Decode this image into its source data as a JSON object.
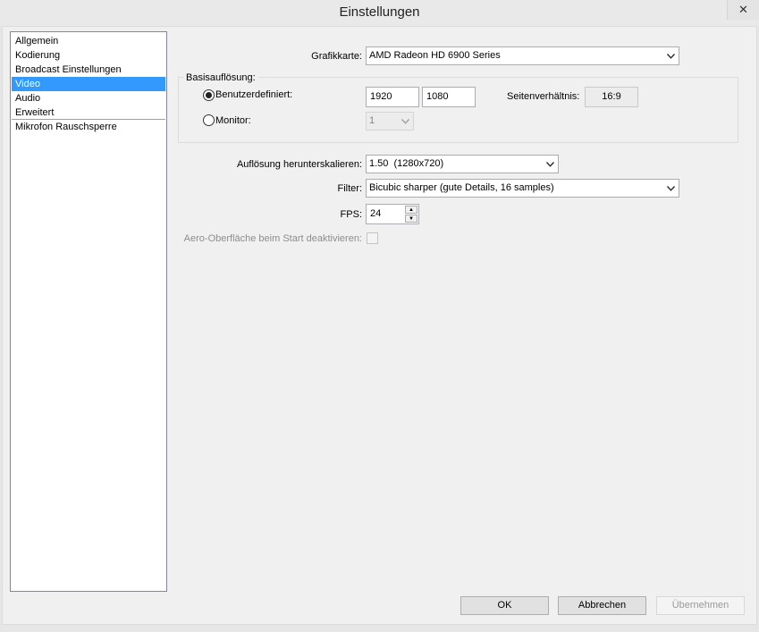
{
  "window": {
    "title": "Einstellungen",
    "close_glyph": "✕"
  },
  "nav": {
    "items": [
      {
        "label": "Allgemein"
      },
      {
        "label": "Kodierung"
      },
      {
        "label": "Broadcast Einstellungen"
      },
      {
        "label": "Video"
      },
      {
        "label": "Audio"
      },
      {
        "label": "Erweitert"
      },
      {
        "label": "Mikrofon Rauschsperre"
      }
    ],
    "selected": "Video"
  },
  "video": {
    "graphics_card": {
      "label": "Grafikkarte:",
      "value": "AMD Radeon HD 6900 Series"
    },
    "base_resolution": {
      "title": "Basisauflösung:",
      "custom_label": "Benutzerdefiniert:",
      "custom_selected": true,
      "width": "1920",
      "height": "1080",
      "aspect_label": "Seitenverhältnis:",
      "aspect_value": "16:9",
      "monitor_label": "Monitor:",
      "monitor_value": "1"
    },
    "downscale": {
      "label": "Auflösung herunterskalieren:",
      "value": "1.50  (1280x720)"
    },
    "filter": {
      "label": "Filter:",
      "value": "Bicubic sharper (gute Details, 16 samples)"
    },
    "fps": {
      "label": "FPS:",
      "value": "24"
    },
    "aero": {
      "label": "Aero-Oberfläche beim Start deaktivieren:",
      "checked": false
    }
  },
  "buttons": {
    "ok": "OK",
    "cancel": "Abbrechen",
    "apply": "Übernehmen"
  },
  "icons": {
    "dropdown_arrow": "chevron-down-icon",
    "spin_up": "▲",
    "spin_down": "▼"
  }
}
